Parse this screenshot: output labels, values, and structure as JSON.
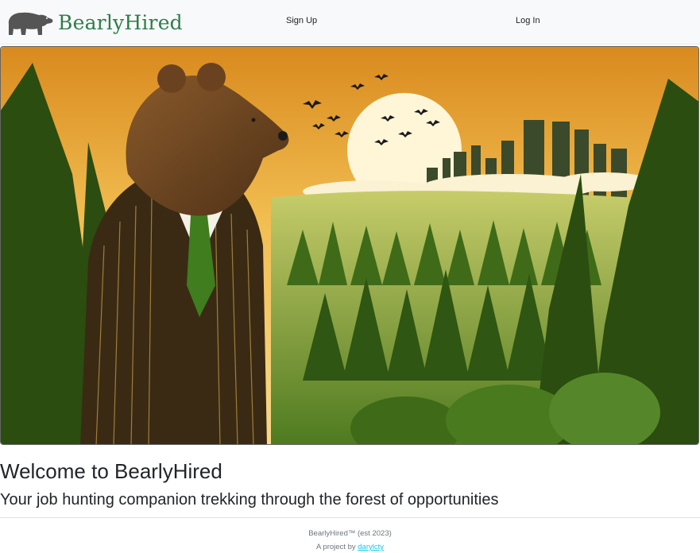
{
  "navbar": {
    "brand_name": "BearlyHired",
    "links": [
      {
        "label": "Sign Up"
      },
      {
        "label": "Log In"
      }
    ]
  },
  "hero": {
    "image_icon": "bear-in-suit-forest-illustration"
  },
  "main": {
    "title": "Welcome to BearlyHired",
    "subtitle": "Your job hunting companion trekking through the forest of opportunities"
  },
  "footer": {
    "copyright": "BearlyHired™ (est 2023)",
    "project_prefix": "A project by ",
    "author_link": "darylcty"
  },
  "colors": {
    "brand_green": "#2e7d4a",
    "navbar_bg": "#f8f9fa",
    "link_color": "#0dcaf0"
  }
}
